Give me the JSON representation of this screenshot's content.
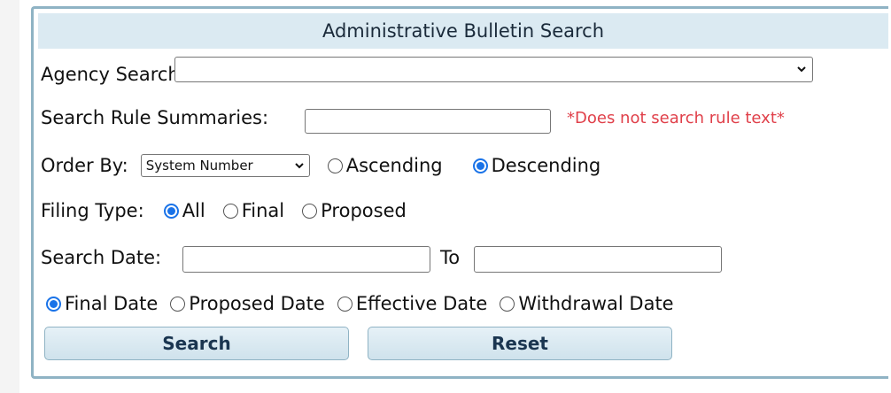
{
  "form": {
    "title": "Administrative Bulletin Search",
    "agency_label": "Agency Search:",
    "agency_value": "",
    "summaries_label": "Search Rule Summaries:",
    "summaries_value": "",
    "summaries_note": "*Does not search rule text*",
    "order_label": "Order By:",
    "order_selected": "System Number",
    "order_options": [
      {
        "label": "Ascending",
        "checked": false
      },
      {
        "label": "Descending",
        "checked": true
      }
    ],
    "filing_label": "Filing Type:",
    "filing_options": [
      {
        "label": "All",
        "checked": true
      },
      {
        "label": "Final",
        "checked": false
      },
      {
        "label": "Proposed",
        "checked": false
      }
    ],
    "date_label": "Search Date:",
    "date_from": "",
    "date_to_label": "To",
    "date_to": "",
    "date_type_options": [
      {
        "label": "Final Date",
        "checked": true
      },
      {
        "label": "Proposed Date",
        "checked": false
      },
      {
        "label": "Effective Date",
        "checked": false
      },
      {
        "label": "Withdrawal Date",
        "checked": false
      }
    ],
    "search_button": "Search",
    "reset_button": "Reset"
  },
  "colors": {
    "header_bg": "#dbeaf2",
    "panel_border": "#8fb3c4",
    "note_red": "#e0404a",
    "radio_blue": "#1a73e8"
  }
}
